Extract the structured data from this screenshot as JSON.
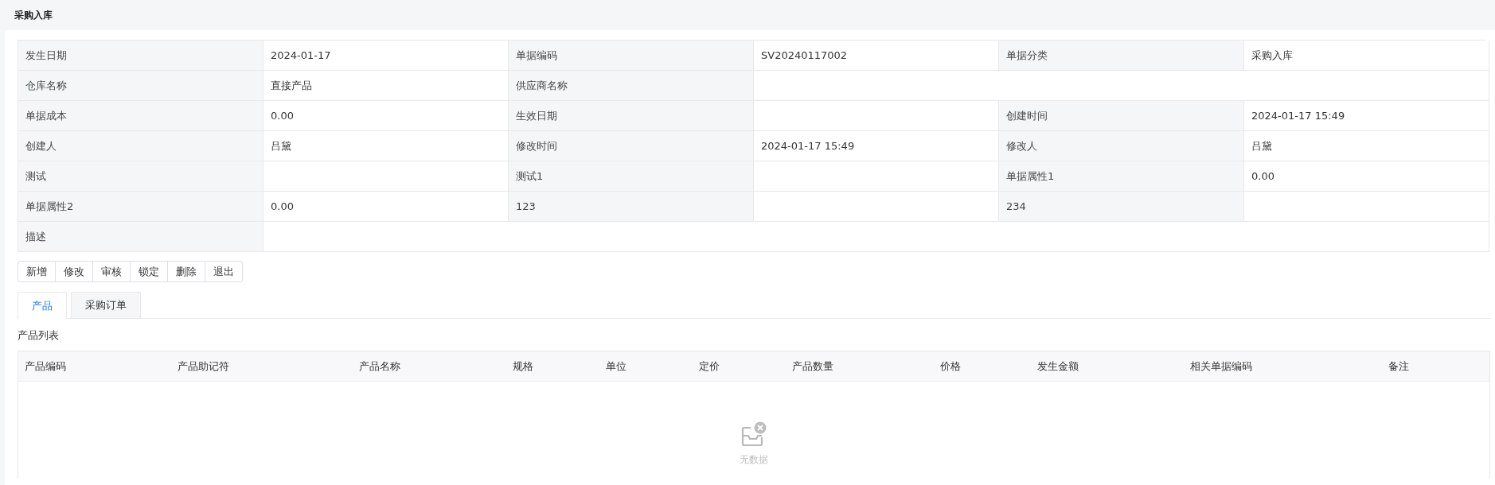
{
  "page": {
    "title": "采购入库"
  },
  "form": {
    "rows": [
      [
        {
          "kind": "label",
          "text": "发生日期"
        },
        {
          "kind": "value",
          "text": "2024-01-17"
        },
        {
          "kind": "label",
          "text": "单据编码"
        },
        {
          "kind": "value",
          "text": "SV20240117002"
        },
        {
          "kind": "label",
          "text": "单据分类"
        },
        {
          "kind": "value",
          "text": "采购入库"
        }
      ],
      [
        {
          "kind": "label",
          "text": "仓库名称"
        },
        {
          "kind": "value",
          "text": "直接产品"
        },
        {
          "kind": "label",
          "text": "供应商名称"
        },
        {
          "kind": "value"
        }
      ],
      [
        {
          "kind": "label",
          "text": "单据成本"
        },
        {
          "kind": "value",
          "text": "0.00"
        },
        {
          "kind": "label",
          "text": "生效日期"
        },
        {
          "kind": "value"
        },
        {
          "kind": "label",
          "text": "创建时间"
        },
        {
          "kind": "value",
          "text": "2024-01-17 15:49"
        }
      ],
      [
        {
          "kind": "label",
          "text": "创建人"
        },
        {
          "kind": "value",
          "text": "吕黛"
        },
        {
          "kind": "label",
          "text": "修改时间"
        },
        {
          "kind": "value",
          "text": "2024-01-17 15:49"
        },
        {
          "kind": "label",
          "text": "修改人"
        },
        {
          "kind": "value",
          "text": "吕黛"
        }
      ],
      [
        {
          "kind": "label",
          "text": "测试"
        },
        {
          "kind": "value"
        },
        {
          "kind": "label",
          "text": "测试1"
        },
        {
          "kind": "value"
        },
        {
          "kind": "label",
          "text": "单据属性1"
        },
        {
          "kind": "value",
          "text": "0.00"
        }
      ],
      [
        {
          "kind": "label",
          "text": "单据属性2"
        },
        {
          "kind": "value",
          "text": "0.00"
        },
        {
          "kind": "label",
          "text": "123"
        },
        {
          "kind": "value"
        },
        {
          "kind": "label",
          "text": "234"
        },
        {
          "kind": "value"
        }
      ],
      [
        {
          "kind": "label",
          "text": "描述"
        },
        {
          "kind": "value"
        }
      ]
    ]
  },
  "buttons": [
    "新增",
    "修改",
    "审核",
    "锁定",
    "删除",
    "退出"
  ],
  "tabs": [
    {
      "label": "产品",
      "selected": true
    },
    {
      "label": "采购订单",
      "selected": false
    }
  ],
  "product_list": {
    "title": "产品列表",
    "columns": [
      "产品编码",
      "产品助记符",
      "产品名称",
      "规格",
      "单位",
      "定价",
      "产品数量",
      "价格",
      "发生金额",
      "相关单据编码",
      "备注"
    ],
    "empty_text": "无数据"
  }
}
